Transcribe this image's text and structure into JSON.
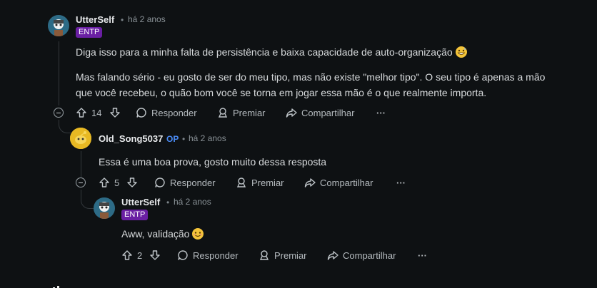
{
  "comments": [
    {
      "username": "UtterSelf",
      "time": "há 2 anos",
      "flair": "ENTP",
      "body_line1": "Diga isso para a minha falta de persistência e baixa capacidade de auto-organização",
      "body_line2": "Mas falando sério - eu gosto de ser do meu tipo, mas não existe \"melhor tipo\". O seu tipo é apenas a mão",
      "body_line3": "que você recebeu, o quão bom você se torna em jogar essa mão é o que realmente importa.",
      "votes": "14"
    },
    {
      "username": "Old_Song5037",
      "op": "OP",
      "time": "há 2 anos",
      "body_line1": "Essa é uma boa prova, gosto muito dessa resposta",
      "votes": "5"
    },
    {
      "username": "UtterSelf",
      "time": "há 2 anos",
      "flair": "ENTP",
      "body_line1": "Aww, validação",
      "votes": "2"
    }
  ],
  "actions": {
    "reply": "Responder",
    "award": "Premiar",
    "share": "Compartilhar",
    "more": "···"
  },
  "dot": "•",
  "icons": [
    "upvote-icon",
    "downvote-icon",
    "comment-icon",
    "award-icon",
    "share-icon",
    "more-icon",
    "collapse-icon"
  ],
  "colors": {
    "background": "#0e1113",
    "flair": "#6a1fa3",
    "op": "#4a8bf5"
  }
}
